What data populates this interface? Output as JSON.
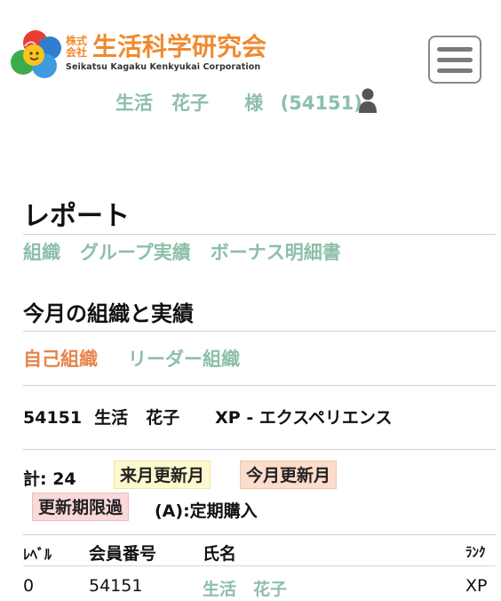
{
  "header": {
    "logo": {
      "kabushiki": "株式会社",
      "main": "生活科学研究会",
      "sub": "Seikatsu Kagaku Kenkyukai Corporation"
    },
    "user_name": "生活　花子　 様 (54151)",
    "icons": {
      "menu": "hamburger-menu-icon",
      "user": "user-icon"
    }
  },
  "report": {
    "title": "レポート",
    "subnav": [
      "組織",
      "グループ実績",
      "ボーナス明細書"
    ]
  },
  "organization": {
    "title": "今月の組織と実績",
    "tabs": {
      "active": "自己組織",
      "inactive": "リーダー組織"
    },
    "member": {
      "id": "54151",
      "last_name": "生活",
      "first_name": "花子",
      "rank": "XP - エクスペリエンス"
    },
    "legend": {
      "total": "計: 24",
      "next_month": "来月更新月",
      "this_month": "今月更新月",
      "expired": "更新期限過",
      "regular": "(A):定期購入"
    }
  },
  "table": {
    "headers": {
      "level": "ﾚﾍﾞﾙ",
      "member_id": "会員番号",
      "name": "氏名",
      "rank": "ﾗﾝｸ"
    },
    "rows": [
      {
        "level": "0",
        "member_id": "54151",
        "name": "生活　花子",
        "rank": "XP"
      }
    ]
  },
  "colors": {
    "accent_green": "#8cbfa9",
    "accent_orange": "#e8844a",
    "logo_orange": "#ef8a2f",
    "badge_next_month": "#fdf9cf",
    "badge_this_month": "#fcdccb",
    "badge_expired": "#f9d9d9"
  }
}
